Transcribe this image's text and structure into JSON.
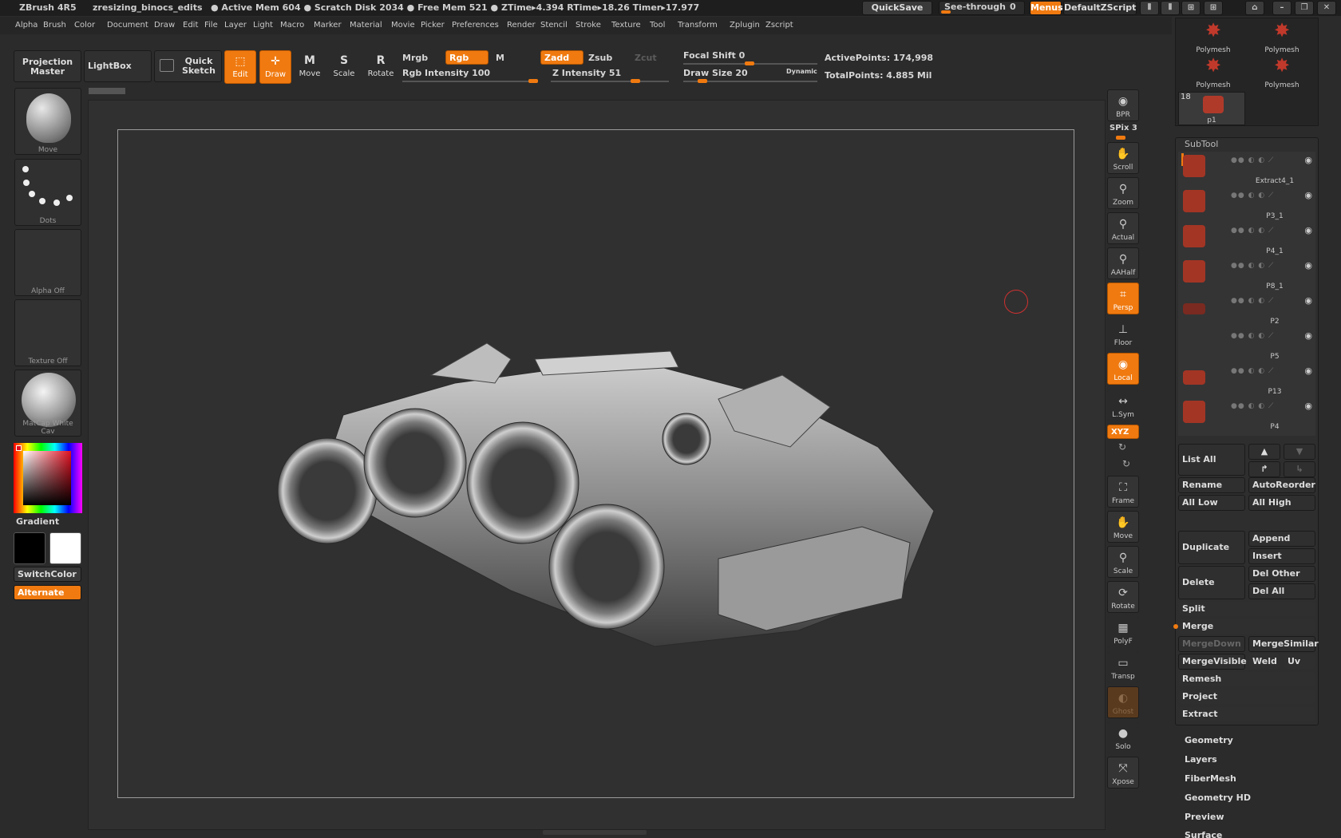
{
  "title_bar": {
    "app_name": "ZBrush 4R5",
    "document": "zresizing_binocs_edits",
    "status": "● Active Mem 604 ● Scratch Disk 2034 ● Free Mem 521 ● ZTime▸4.394 RTime▸18.26 Timer▸17.977",
    "quicksave": "QuickSave",
    "see_through_label": "See-through",
    "see_through_value": "0",
    "menus": "Menus",
    "zscript": "DefaultZScript"
  },
  "menu": [
    "Alpha",
    "Brush",
    "Color",
    "Document",
    "Draw",
    "Edit",
    "File",
    "Layer",
    "Light",
    "Macro",
    "Marker",
    "Material",
    "Movie",
    "Picker",
    "Preferences",
    "Render",
    "Stencil",
    "Stroke",
    "Texture",
    "Tool",
    "Transform",
    "Zplugin",
    "Zscript"
  ],
  "toolbar": {
    "projection_master": "Projection Master",
    "lightbox": "LightBox",
    "quick_sketch": "Quick Sketch",
    "edit": "Edit",
    "draw": "Draw",
    "move": "Move",
    "scale": "Scale",
    "rotate": "Rotate",
    "mrgb": "Mrgb",
    "rgb": "Rgb",
    "m": "M",
    "rgb_intensity": "Rgb Intensity 100",
    "rgb_intensity_value": 100,
    "zadd": "Zadd",
    "zsub": "Zsub",
    "zcut": "Zcut",
    "z_intensity": "Z Intensity 51",
    "z_intensity_value": 51,
    "focal_shift": "Focal Shift 0",
    "focal_shift_value": 0,
    "draw_size": "Draw Size 20",
    "draw_size_value": 20,
    "dynamic": "Dynamic",
    "active_points": "ActivePoints: 174,998",
    "total_points": "TotalPoints: 4.885 Mil"
  },
  "left_shelf": {
    "move": "Move",
    "dots": "Dots",
    "alpha": "Alpha Off",
    "texture": "Texture Off",
    "matcap": "MatCap White Cav",
    "gradient": "Gradient",
    "switch_color": "SwitchColor",
    "alternate": "Alternate",
    "main_color": "#000000",
    "secondary_color": "#ffffff"
  },
  "right_shelf": {
    "bpr": "BPR",
    "spix": "SPix 3",
    "scroll": "Scroll",
    "zoom": "Zoom",
    "actual": "Actual",
    "aahalf": "AAHalf",
    "persp": "Persp",
    "floor": "Floor",
    "local": "Local",
    "lsym": "L.Sym",
    "xyz": "XYZ",
    "frame": "Frame",
    "move": "Move",
    "scale": "Scale",
    "rotate": "Rotate",
    "polyf": "PolyF",
    "transp": "Transp",
    "ghost": "Ghost",
    "solo": "Solo",
    "xpose": "Xpose"
  },
  "tool_palette": {
    "polymesh_items": [
      "Polymesh",
      "Polymesh",
      "Polymesh",
      "Polymesh"
    ],
    "tool_count": "18",
    "tool_name": "p1",
    "subtool_title": "SubTool",
    "subtools": [
      "Extract4_1",
      "P3_1",
      "P4_1",
      "P8_1",
      "P2",
      "P5",
      "P13",
      "P4"
    ]
  },
  "subtool_buttons": {
    "list_all": "List All",
    "rename": "Rename",
    "auto_reorder": "AutoReorder",
    "all_low": "All Low",
    "all_high": "All High",
    "duplicate": "Duplicate",
    "append": "Append",
    "insert": "Insert",
    "delete": "Delete",
    "del_other": "Del Other",
    "del_all": "Del All",
    "split": "Split",
    "merge": "Merge",
    "merge_down": "MergeDown",
    "merge_similar": "MergeSimilar",
    "merge_visible": "MergeVisible",
    "weld": "Weld",
    "uv": "Uv",
    "remesh": "Remesh",
    "project": "Project",
    "extract": "Extract"
  },
  "tool_sections": [
    "Geometry",
    "Layers",
    "FiberMesh",
    "Geometry HD",
    "Preview",
    "Surface"
  ],
  "accent_color": "#f07a10"
}
